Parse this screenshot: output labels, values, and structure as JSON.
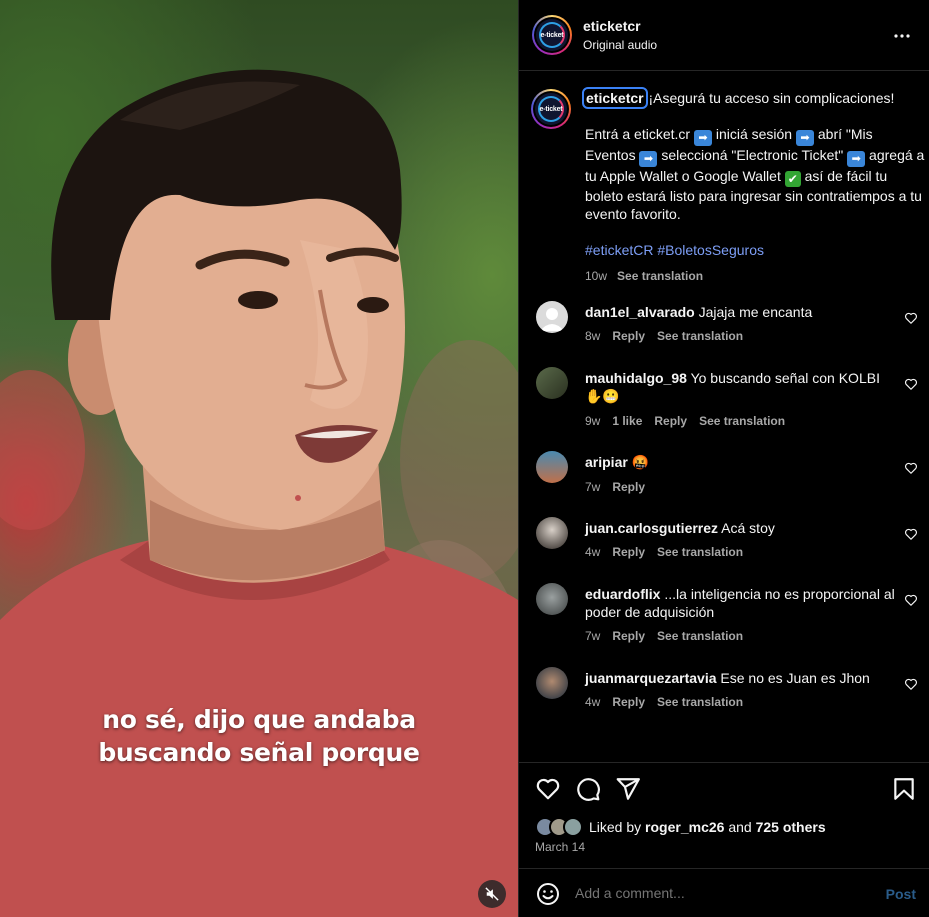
{
  "video": {
    "caption_lines": [
      "no sé, dijo que andaba",
      "buscando señal porque"
    ],
    "mute_icon": "speaker-muted-icon"
  },
  "header": {
    "username": "eticketcr",
    "audio": "Original audio",
    "avatar_text": "e-ticket",
    "more_icon": "more-horizontal-icon"
  },
  "post": {
    "username": "eticketcr",
    "headline": "¡Asegurá tu acceso sin complicaciones!",
    "body_parts": [
      "Entrá a eticket.cr ",
      " iniciá sesión ",
      " abrí \"Mis Eventos ",
      " seleccioná \"Electronic Ticket\" ",
      " agregá a tu Apple Wallet o Google Wallet ",
      " así de fácil tu boleto estará listo para ingresar sin contratiempos a tu evento favorito."
    ],
    "arrow_glyph": "➡",
    "check_glyph": "✔",
    "hashtags": "#eticketCR #BoletosSeguros",
    "age": "10w",
    "translate": "See translation"
  },
  "comments": [
    {
      "user": "dan1el_alvarado",
      "text": "Jajaja me encanta",
      "age": "8w",
      "likes": "",
      "reply": "Reply",
      "translate": "See translation"
    },
    {
      "user": "mauhidalgo_98",
      "text": "Yo buscando señal con KOLBI",
      "emoji": "✋😬",
      "age": "9w",
      "likes": "1 like",
      "reply": "Reply",
      "translate": "See translation"
    },
    {
      "user": "aripiar",
      "text": "",
      "emoji": "🤬",
      "age": "7w",
      "likes": "",
      "reply": "Reply",
      "translate": ""
    },
    {
      "user": "juan.carlosgutierrez",
      "text": "Acá stoy",
      "age": "4w",
      "likes": "",
      "reply": "Reply",
      "translate": "See translation"
    },
    {
      "user": "eduardoflix",
      "text": "...la inteligencia no es proporcional al poder de adquisición",
      "age": "7w",
      "likes": "",
      "reply": "Reply",
      "translate": "See translation"
    },
    {
      "user": "juanmarquezartavia",
      "text": "Ese no es Juan es Jhon",
      "age": "4w",
      "likes": "",
      "reply": "Reply",
      "translate": "See translation"
    }
  ],
  "actions": {
    "liked_by_prefix": "Liked by",
    "liked_by_user": "roger_mc26",
    "liked_by_and": "and",
    "others": "725 others",
    "date": "March 14"
  },
  "composer": {
    "placeholder": "Add a comment...",
    "post_label": "Post"
  },
  "colors": {
    "background": "#000000",
    "text": "#f5f5f5",
    "muted": "#a8a8a8",
    "hashtag": "#7d9ef5",
    "post_button": "#2a5c8a",
    "divider": "#262626"
  }
}
